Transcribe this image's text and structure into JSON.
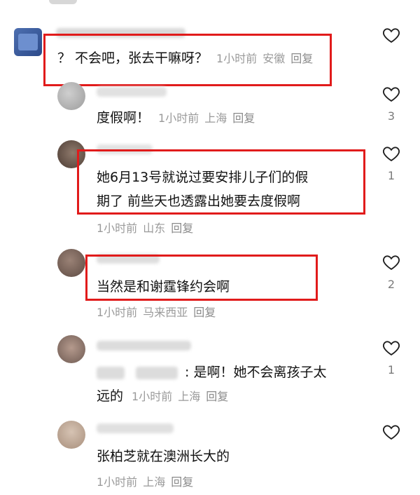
{
  "comments": [
    {
      "text": "？ 不会吧，张去干嘛呀？",
      "time": "1小时前",
      "location": "安徽",
      "reply": "回复",
      "likes": ""
    },
    {
      "text": "度假啊！",
      "time": "1小时前",
      "location": "上海",
      "reply": "回复",
      "likes": "3"
    },
    {
      "line1": "她6月13号就说过要安排儿子们的假",
      "line2": "期了 前些天也透露出她要去度假啊",
      "time": "1小时前",
      "location": "山东",
      "reply": "回复",
      "likes": "1"
    },
    {
      "text": "当然是和谢霆锋约会啊",
      "time": "1小时前",
      "location": "马来西亚",
      "reply": "回复",
      "likes": "2"
    },
    {
      "line1_suffix": ": 是啊！她不会离孩子太",
      "line2": "远的",
      "time": "1小时前",
      "location": "上海",
      "reply": "回复",
      "likes": "1"
    },
    {
      "text": "张柏芝就在澳洲长大的",
      "time": "1小时前",
      "location": "上海",
      "reply": "回复",
      "likes": ""
    }
  ],
  "icons": {
    "like": "heart-outline-icon"
  },
  "colors": {
    "highlight_box": "#e11b1b",
    "meta": "#9a9a9a"
  }
}
